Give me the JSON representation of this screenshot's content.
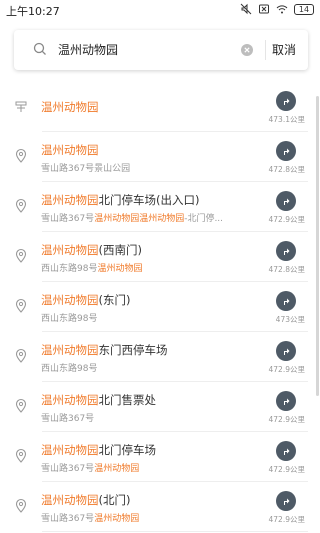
{
  "status": {
    "time": "上午10:27",
    "battery": "14"
  },
  "search": {
    "query": "温州动物园",
    "cancel_label": "取消"
  },
  "results": [
    {
      "icon": "signpost-icon",
      "title_hl": "温州动物园",
      "title_rest": "",
      "sub_plain": "",
      "sub_hl": "",
      "sub_rest": "",
      "distance": "473.1公里"
    },
    {
      "icon": "location-pin-icon",
      "title_hl": "温州动物园",
      "title_rest": "",
      "sub_plain": "雪山路367号景山公园",
      "sub_hl": "",
      "sub_rest": "",
      "distance": "472.8公里"
    },
    {
      "icon": "location-pin-icon",
      "title_hl": "温州动物园",
      "title_rest": "北门停车场(出入口)",
      "sub_plain": "雪山路367号",
      "sub_hl": "温州动物园温州动物园",
      "sub_rest": "-北门停...",
      "distance": "472.9公里"
    },
    {
      "icon": "location-pin-icon",
      "title_hl": "温州动物园",
      "title_rest": "(西南门)",
      "sub_plain": "西山东路98号",
      "sub_hl": "温州动物园",
      "sub_rest": "",
      "distance": "472.8公里"
    },
    {
      "icon": "location-pin-icon",
      "title_hl": "温州动物园",
      "title_rest": "(东门)",
      "sub_plain": "西山东路98号",
      "sub_hl": "",
      "sub_rest": "",
      "distance": "473公里"
    },
    {
      "icon": "location-pin-icon",
      "title_hl": "温州动物园",
      "title_rest": "东门西停车场",
      "sub_plain": "西山东路98号",
      "sub_hl": "",
      "sub_rest": "",
      "distance": "472.9公里"
    },
    {
      "icon": "location-pin-icon",
      "title_hl": "温州动物园",
      "title_rest": "北门售票处",
      "sub_plain": "雪山路367号",
      "sub_hl": "",
      "sub_rest": "",
      "distance": "472.9公里"
    },
    {
      "icon": "location-pin-icon",
      "title_hl": "温州动物园",
      "title_rest": "北门停车场",
      "sub_plain": "雪山路367号",
      "sub_hl": "温州动物园",
      "sub_rest": "",
      "distance": "472.9公里"
    },
    {
      "icon": "location-pin-icon",
      "title_hl": "温州动物园",
      "title_rest": "(北门)",
      "sub_plain": "雪山路367号",
      "sub_hl": "温州动物园",
      "sub_rest": "",
      "distance": "472.9公里"
    }
  ]
}
